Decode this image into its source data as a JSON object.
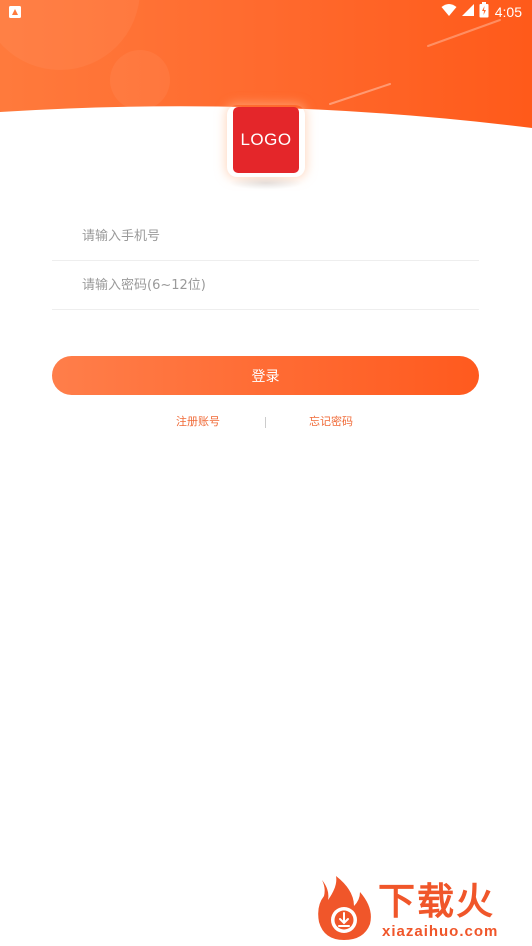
{
  "status_bar": {
    "time": "4:05"
  },
  "logo": {
    "text": "LOGO"
  },
  "form": {
    "phone_placeholder": "请输入手机号",
    "password_placeholder": "请输入密码(6~12位)",
    "phone_value": "",
    "password_value": "",
    "login_label": "登录"
  },
  "links": {
    "register": "注册账号",
    "divider": "|",
    "forgot": "忘记密码"
  },
  "watermark": {
    "title": "下载火",
    "url": "xiazaihuo.com"
  },
  "colors": {
    "accent": "#ff6a32",
    "logo_red": "#e4262a",
    "link": "#f06a37"
  }
}
